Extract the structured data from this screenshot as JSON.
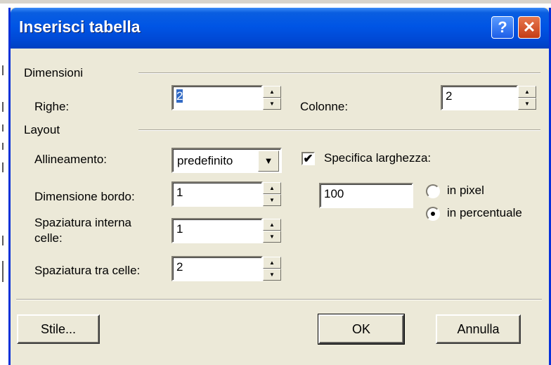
{
  "window": {
    "title": "Inserisci tabella",
    "help_glyph": "?",
    "close_glyph": "✕"
  },
  "dimensions": {
    "section_label": "Dimensioni",
    "rows_label": "Righe:",
    "rows_value": "2",
    "cols_label": "Colonne:",
    "cols_value": "2"
  },
  "layout": {
    "section_label": "Layout",
    "alignment_label": "Allineamento:",
    "alignment_value": "predefinito",
    "border_label": "Dimensione bordo:",
    "border_value": "1",
    "padding_label_line1": "Spaziatura interna",
    "padding_label_line2": "celle:",
    "padding_value": "1",
    "spacing_label": "Spaziatura tra celle:",
    "spacing_value": "2",
    "width_checkbox_label": "Specifica larghezza:",
    "width_checked": true,
    "width_value": "100",
    "unit_pixel_label": "in pixel",
    "unit_percent_label": "in percentuale",
    "unit_selected": "in percentuale"
  },
  "buttons": {
    "style_label": "Stile...",
    "ok_label": "OK",
    "cancel_label": "Annulla"
  },
  "icons": {
    "spin_up": "▲",
    "spin_down": "▼",
    "dropdown_arrow": "▼",
    "check_mark": "✔"
  },
  "colors": {
    "titlebar": "#0055e5",
    "dialog_bg": "#ece9d8",
    "selection": "#316ac5",
    "close_button": "#c43c15"
  }
}
